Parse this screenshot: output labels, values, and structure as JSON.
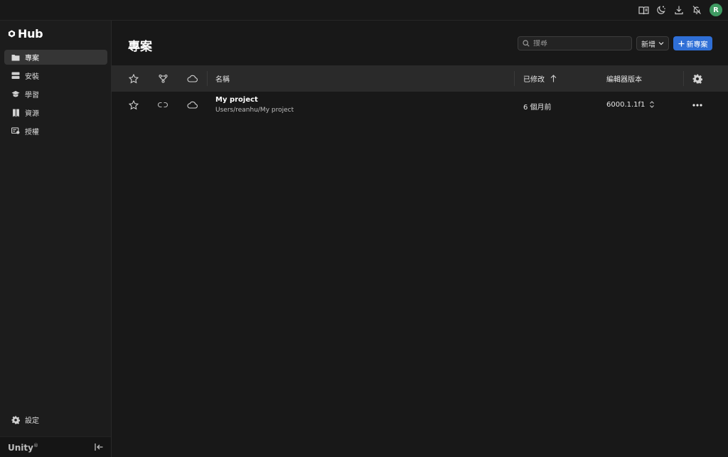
{
  "topbar": {
    "icons": [
      "book-icon",
      "moon-icon",
      "download-icon",
      "bell-off-icon"
    ],
    "avatar_initial": "R"
  },
  "sidebar": {
    "logo_text": "Hub",
    "items": [
      {
        "label": "專案",
        "icon": "folder-icon",
        "active": true
      },
      {
        "label": "安裝",
        "icon": "server-icon",
        "active": false
      },
      {
        "label": "學習",
        "icon": "graduation-cap-icon",
        "active": false
      },
      {
        "label": "資源",
        "icon": "bookmarks-icon",
        "active": false
      },
      {
        "label": "授權",
        "icon": "license-icon",
        "active": false
      }
    ],
    "settings_label": "設定",
    "brand": "Unity",
    "brand_mark": "®"
  },
  "main": {
    "title": "專案",
    "search": {
      "placeholder": "搜尋",
      "value": ""
    },
    "add_dropdown_label": "新增",
    "new_project_label": "新專案",
    "table": {
      "columns": {
        "name": "名稱",
        "modified": "已修改",
        "editor_version": "編輯器版本"
      },
      "sort_direction": "ascending",
      "rows": [
        {
          "name": "My project",
          "path": "Users/reanhu/My project",
          "modified": "6 個月前",
          "editor_version": "6000.1.1f1"
        }
      ]
    }
  },
  "colors": {
    "accent": "#2f6fd6",
    "avatar": "#3f9a62",
    "background": "#181818",
    "sidebar": "#1c1c1c",
    "header_row": "#2a2a2a"
  }
}
